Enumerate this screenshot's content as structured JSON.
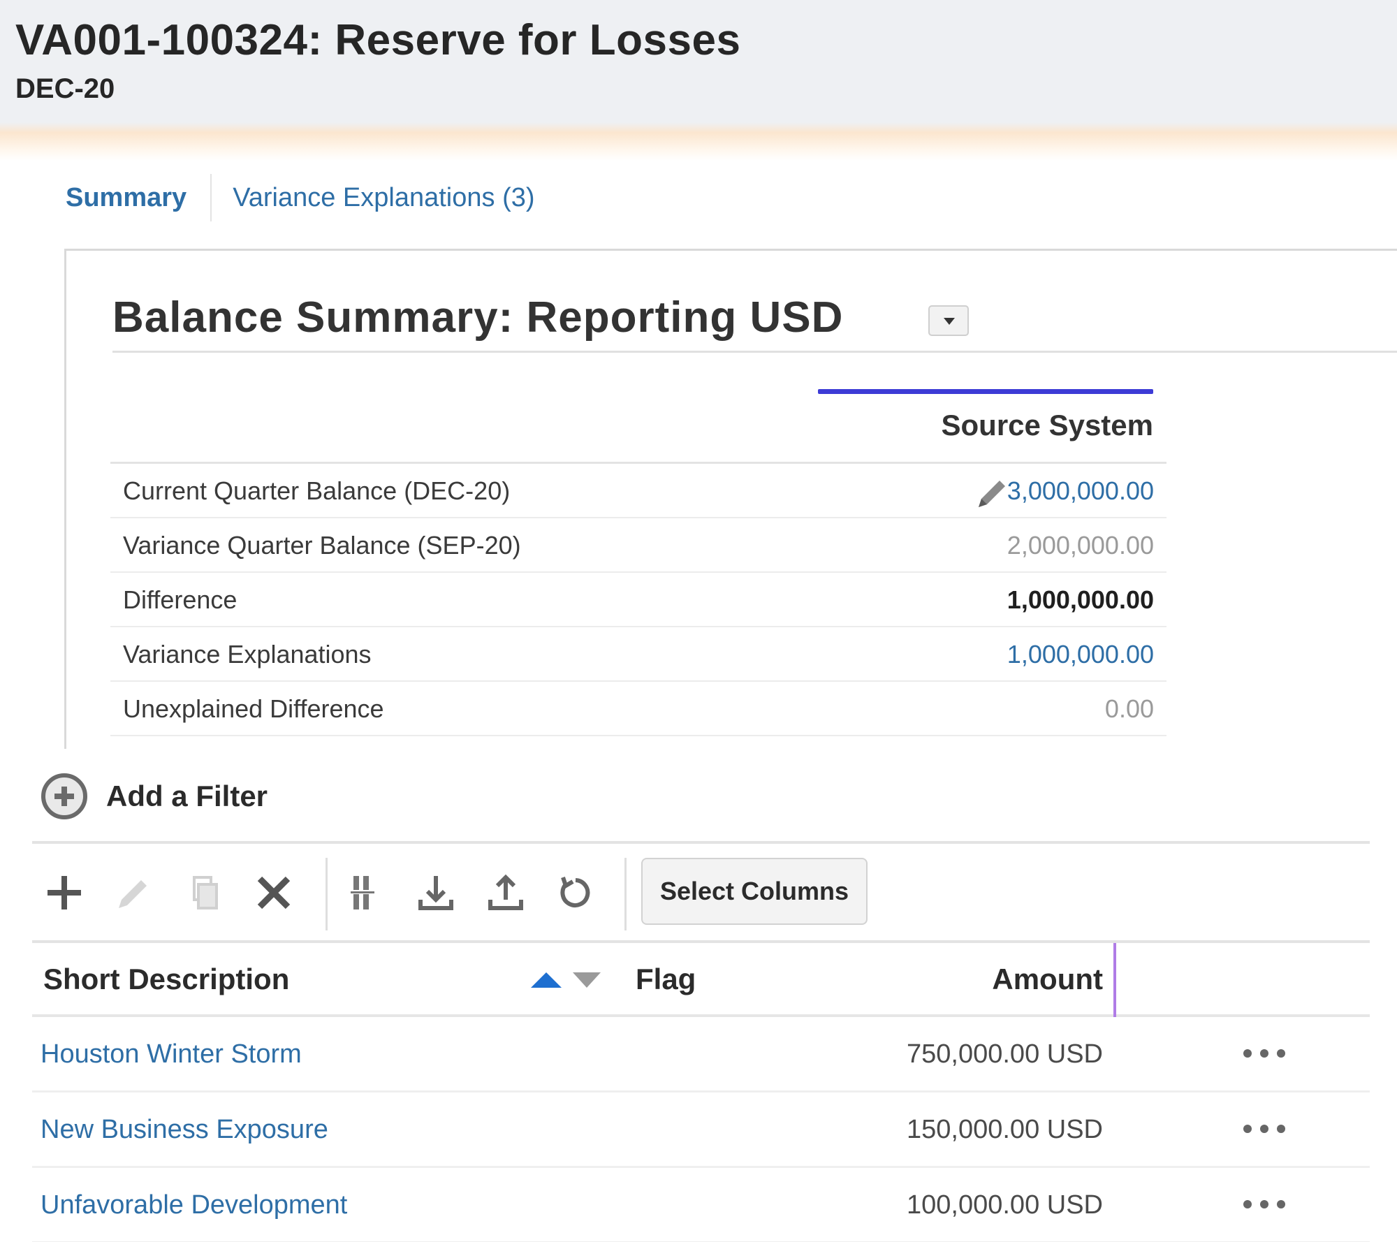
{
  "header": {
    "title": "VA001-100324: Reserve for Losses",
    "period": "DEC-20"
  },
  "tabs": [
    {
      "label": "Summary",
      "active": true
    },
    {
      "label": "Variance Explanations (3)",
      "active": false
    }
  ],
  "balance_summary": {
    "title": "Balance Summary: Reporting USD",
    "column_header": "Source System",
    "rows": [
      {
        "label": "Current Quarter Balance (DEC-20)",
        "value": "3,000,000.00",
        "editable": true
      },
      {
        "label": "Variance Quarter Balance (SEP-20)",
        "value": "2,000,000.00"
      },
      {
        "label": "Difference",
        "value": "1,000,000.00"
      },
      {
        "label": "Variance Explanations",
        "value": "1,000,000.00"
      },
      {
        "label": "Unexplained Difference",
        "value": "0.00"
      }
    ]
  },
  "filter": {
    "label": "Add a Filter"
  },
  "toolbar": {
    "select_columns_label": "Select Columns",
    "icons": [
      "add-icon",
      "edit-icon",
      "copy-icon",
      "delete-icon",
      "column-settings-icon",
      "download-icon",
      "upload-icon",
      "refresh-icon"
    ]
  },
  "table": {
    "columns": [
      "Short Description",
      "Flag",
      "Amount"
    ],
    "rows": [
      {
        "description": "Houston Winter Storm",
        "flag": "",
        "amount": "750,000.00 USD"
      },
      {
        "description": "New Business Exposure",
        "flag": "",
        "amount": "150,000.00 USD"
      },
      {
        "description": "Unfavorable Development",
        "flag": "",
        "amount": "100,000.00 USD"
      }
    ]
  },
  "colors": {
    "link": "#2e6ea6",
    "accent_bar": "#3d3bd6",
    "sort_active": "#1e6fd0"
  }
}
